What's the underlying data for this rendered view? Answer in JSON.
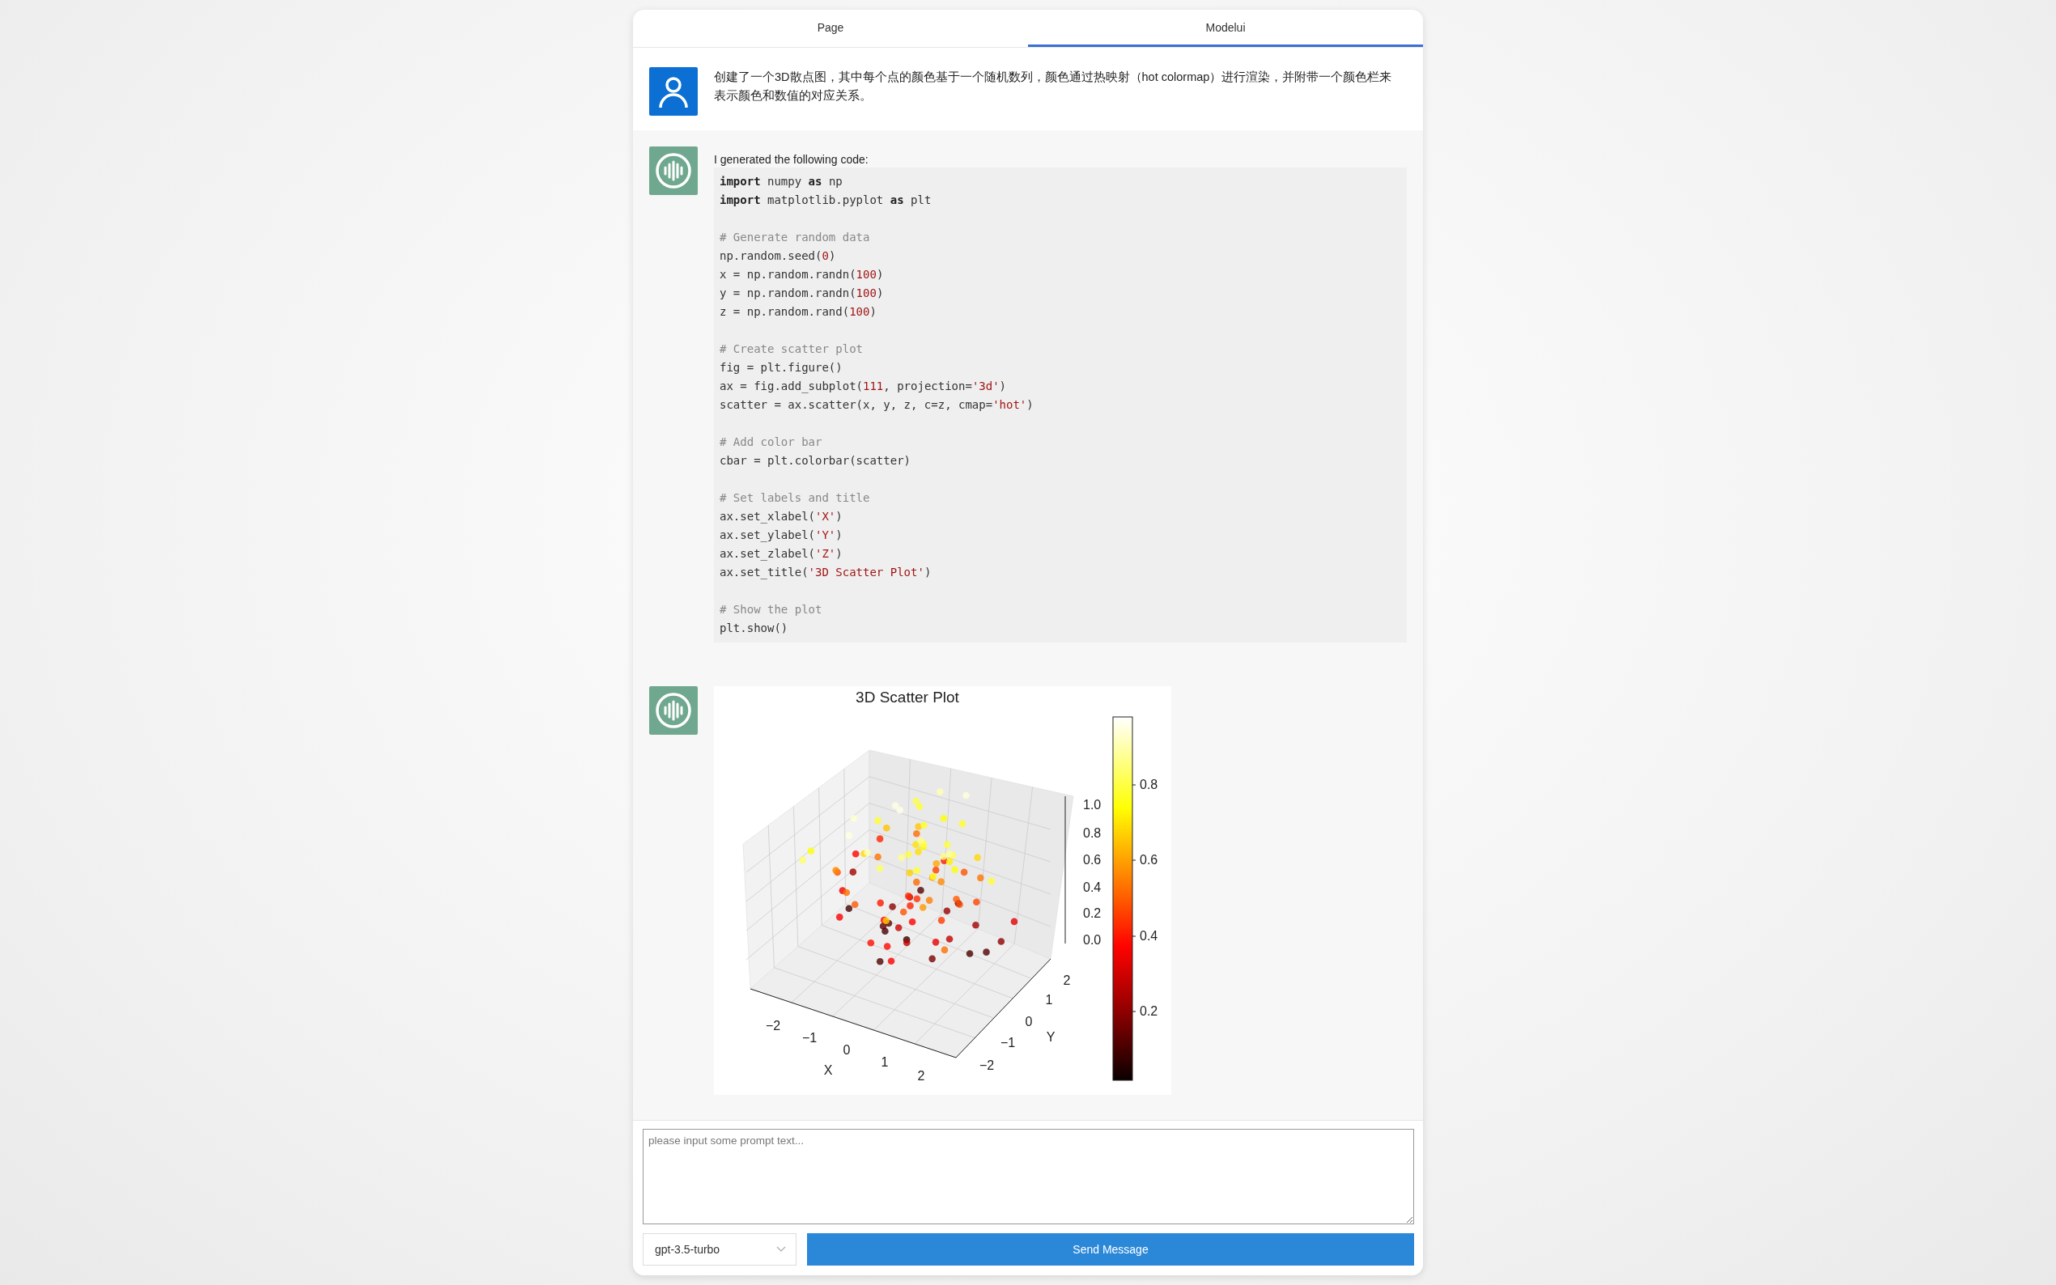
{
  "tabs": [
    {
      "label": "Page",
      "selected": false
    },
    {
      "label": "Modelui",
      "selected": true
    }
  ],
  "messages": [
    {
      "kind": "user",
      "text": "创建了一个3D散点图，其中每个点的颜色基于一个随机数列，颜色通过热映射（hot colormap）进行渲染，并附带一个颜色栏来表示颜色和数值的对应关系。"
    },
    {
      "kind": "code",
      "intro": "I generated the following code:",
      "code_blocks": [
        [
          [
            {
              "kind": "kw",
              "t": "import"
            },
            {
              "kind": "plain",
              "t": " numpy "
            },
            {
              "kind": "kw",
              "t": "as"
            },
            {
              "kind": "plain",
              "t": " np"
            }
          ],
          [
            {
              "kind": "kw",
              "t": "import"
            },
            {
              "kind": "plain",
              "t": " matplotlib.pyplot "
            },
            {
              "kind": "kw",
              "t": "as"
            },
            {
              "kind": "plain",
              "t": " plt"
            }
          ]
        ],
        [
          [
            {
              "kind": "comment",
              "t": "# Generate random data"
            }
          ],
          [
            {
              "kind": "plain",
              "t": "np.random.seed("
            },
            {
              "kind": "lit",
              "t": "0"
            },
            {
              "kind": "plain",
              "t": ")"
            }
          ],
          [
            {
              "kind": "plain",
              "t": "x = np.random.randn("
            },
            {
              "kind": "lit",
              "t": "100"
            },
            {
              "kind": "plain",
              "t": ")"
            }
          ],
          [
            {
              "kind": "plain",
              "t": "y = np.random.randn("
            },
            {
              "kind": "lit",
              "t": "100"
            },
            {
              "kind": "plain",
              "t": ")"
            }
          ],
          [
            {
              "kind": "plain",
              "t": "z = np.random.rand("
            },
            {
              "kind": "lit",
              "t": "100"
            },
            {
              "kind": "plain",
              "t": ")"
            }
          ]
        ],
        [
          [
            {
              "kind": "comment",
              "t": "# Create scatter plot"
            }
          ],
          [
            {
              "kind": "plain",
              "t": "fig = plt.figure()"
            }
          ],
          [
            {
              "kind": "plain",
              "t": "ax = fig.add_subplot("
            },
            {
              "kind": "lit",
              "t": "111"
            },
            {
              "kind": "plain",
              "t": ", projection="
            },
            {
              "kind": "lit",
              "t": "'3d'"
            },
            {
              "kind": "plain",
              "t": ")"
            }
          ],
          [
            {
              "kind": "plain",
              "t": "scatter = ax.scatter(x, y, z, c=z, cmap="
            },
            {
              "kind": "lit",
              "t": "'hot'"
            },
            {
              "kind": "plain",
              "t": ")"
            }
          ]
        ],
        [
          [
            {
              "kind": "comment",
              "t": "# Add color bar"
            }
          ],
          [
            {
              "kind": "plain",
              "t": "cbar = plt.colorbar(scatter)"
            }
          ]
        ],
        [
          [
            {
              "kind": "comment",
              "t": "# Set labels and title"
            }
          ],
          [
            {
              "kind": "plain",
              "t": "ax.set_xlabel("
            },
            {
              "kind": "lit",
              "t": "'X'"
            },
            {
              "kind": "plain",
              "t": ")"
            }
          ],
          [
            {
              "kind": "plain",
              "t": "ax.set_ylabel("
            },
            {
              "kind": "lit",
              "t": "'Y'"
            },
            {
              "kind": "plain",
              "t": ")"
            }
          ],
          [
            {
              "kind": "plain",
              "t": "ax.set_zlabel("
            },
            {
              "kind": "lit",
              "t": "'Z'"
            },
            {
              "kind": "plain",
              "t": ")"
            }
          ],
          [
            {
              "kind": "plain",
              "t": "ax.set_title("
            },
            {
              "kind": "lit",
              "t": "'3D Scatter Plot'"
            },
            {
              "kind": "plain",
              "t": ")"
            }
          ]
        ],
        [
          [
            {
              "kind": "comment",
              "t": "# Show the plot"
            }
          ],
          [
            {
              "kind": "plain",
              "t": "plt.show()"
            }
          ]
        ]
      ]
    },
    {
      "kind": "plot",
      "plot": {
        "title": "3D Scatter Plot",
        "x_label": "X",
        "y_label": "Y",
        "x_ticks": [
          "−2",
          "−1",
          "0",
          "1",
          "2"
        ],
        "y_ticks": [
          "2",
          "1",
          "0",
          "−1",
          "−2"
        ],
        "z_ticks": [
          "1.0",
          "0.8",
          "0.6",
          "0.4",
          "0.2",
          "0.0"
        ],
        "colorbar_ticks": [
          "0.8",
          "0.6",
          "0.4",
          "0.2"
        ]
      }
    }
  ],
  "composer": {
    "placeholder": "please input some prompt text...",
    "model": "gpt-3.5-turbo",
    "send_label": "Send Message"
  }
}
